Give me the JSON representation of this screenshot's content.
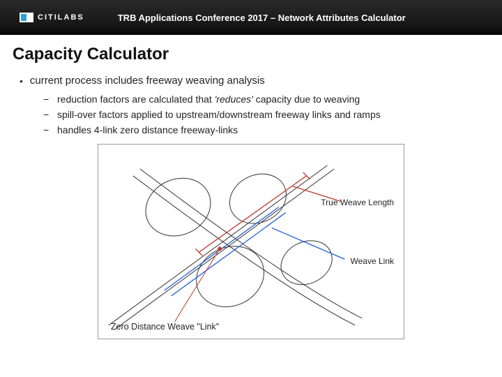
{
  "header": {
    "brand": "CITILABS",
    "conference_title": "TRB Applications Conference 2017 – Network Attributes Calculator"
  },
  "slide": {
    "title": "Capacity Calculator",
    "bullet_main": "current process includes freeway weaving analysis",
    "sub_bullets": [
      {
        "pre": "reduction factors are calculated that ",
        "em": "'reduces'",
        "post": " capacity due to weaving"
      },
      {
        "pre": "spill-over factors applied to upstream/downstream freeway links and ramps",
        "em": "",
        "post": ""
      },
      {
        "pre": "handles 4-link zero distance freeway-links",
        "em": "",
        "post": ""
      }
    ],
    "diagram_labels": {
      "true_weave": "True Weave Length",
      "weave_link": "Weave Link",
      "zero_dist": "Zero Distance Weave \"Link\""
    }
  }
}
